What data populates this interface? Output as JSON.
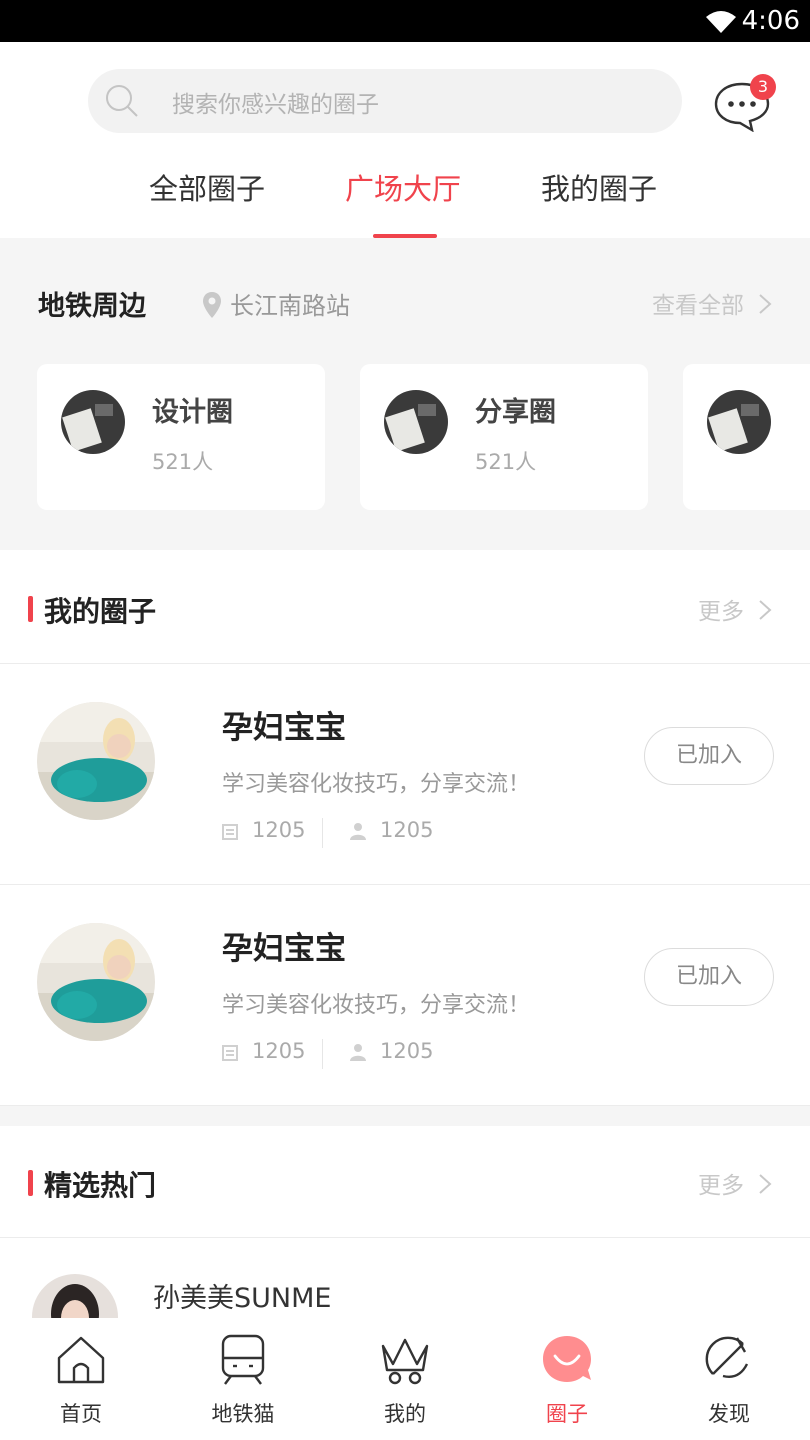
{
  "status_bar": {
    "time": "4:06"
  },
  "search": {
    "placeholder": "搜索你感兴趣的圈子"
  },
  "messages": {
    "badge_count": "3"
  },
  "tabs": [
    {
      "label": "全部圈子",
      "active": false
    },
    {
      "label": "广场大厅",
      "active": true
    },
    {
      "label": "我的圈子",
      "active": false
    }
  ],
  "metro": {
    "title": "地铁周边",
    "station": "长江南路站",
    "view_all": "查看全部",
    "circles": [
      {
        "name": "设计圈",
        "count": "521人"
      },
      {
        "name": "分享圈",
        "count": "521人"
      }
    ]
  },
  "my_circles": {
    "title": "我的圈子",
    "more": "更多",
    "groups": [
      {
        "name": "孕妇宝宝",
        "desc": "学习美容化妆技巧，分享交流！",
        "posts": "1205",
        "members": "1205",
        "action": "已加入"
      },
      {
        "name": "孕妇宝宝",
        "desc": "学习美容化妆技巧，分享交流！",
        "posts": "1205",
        "members": "1205",
        "action": "已加入"
      }
    ]
  },
  "hot": {
    "title": "精选热门",
    "more": "更多",
    "first_post_author": "孙美美SUNME"
  },
  "tabbar": [
    {
      "label": "首页",
      "icon": "home-icon",
      "active": false
    },
    {
      "label": "地铁猫",
      "icon": "metro-train-icon",
      "active": false
    },
    {
      "label": "我的",
      "icon": "crown-icon",
      "active": false
    },
    {
      "label": "圈子",
      "icon": "circle-chat-icon",
      "active": true
    },
    {
      "label": "发现",
      "icon": "discover-icon",
      "active": false
    }
  ],
  "colors": {
    "accent": "#f0434c",
    "background": "#f5f5f5"
  }
}
